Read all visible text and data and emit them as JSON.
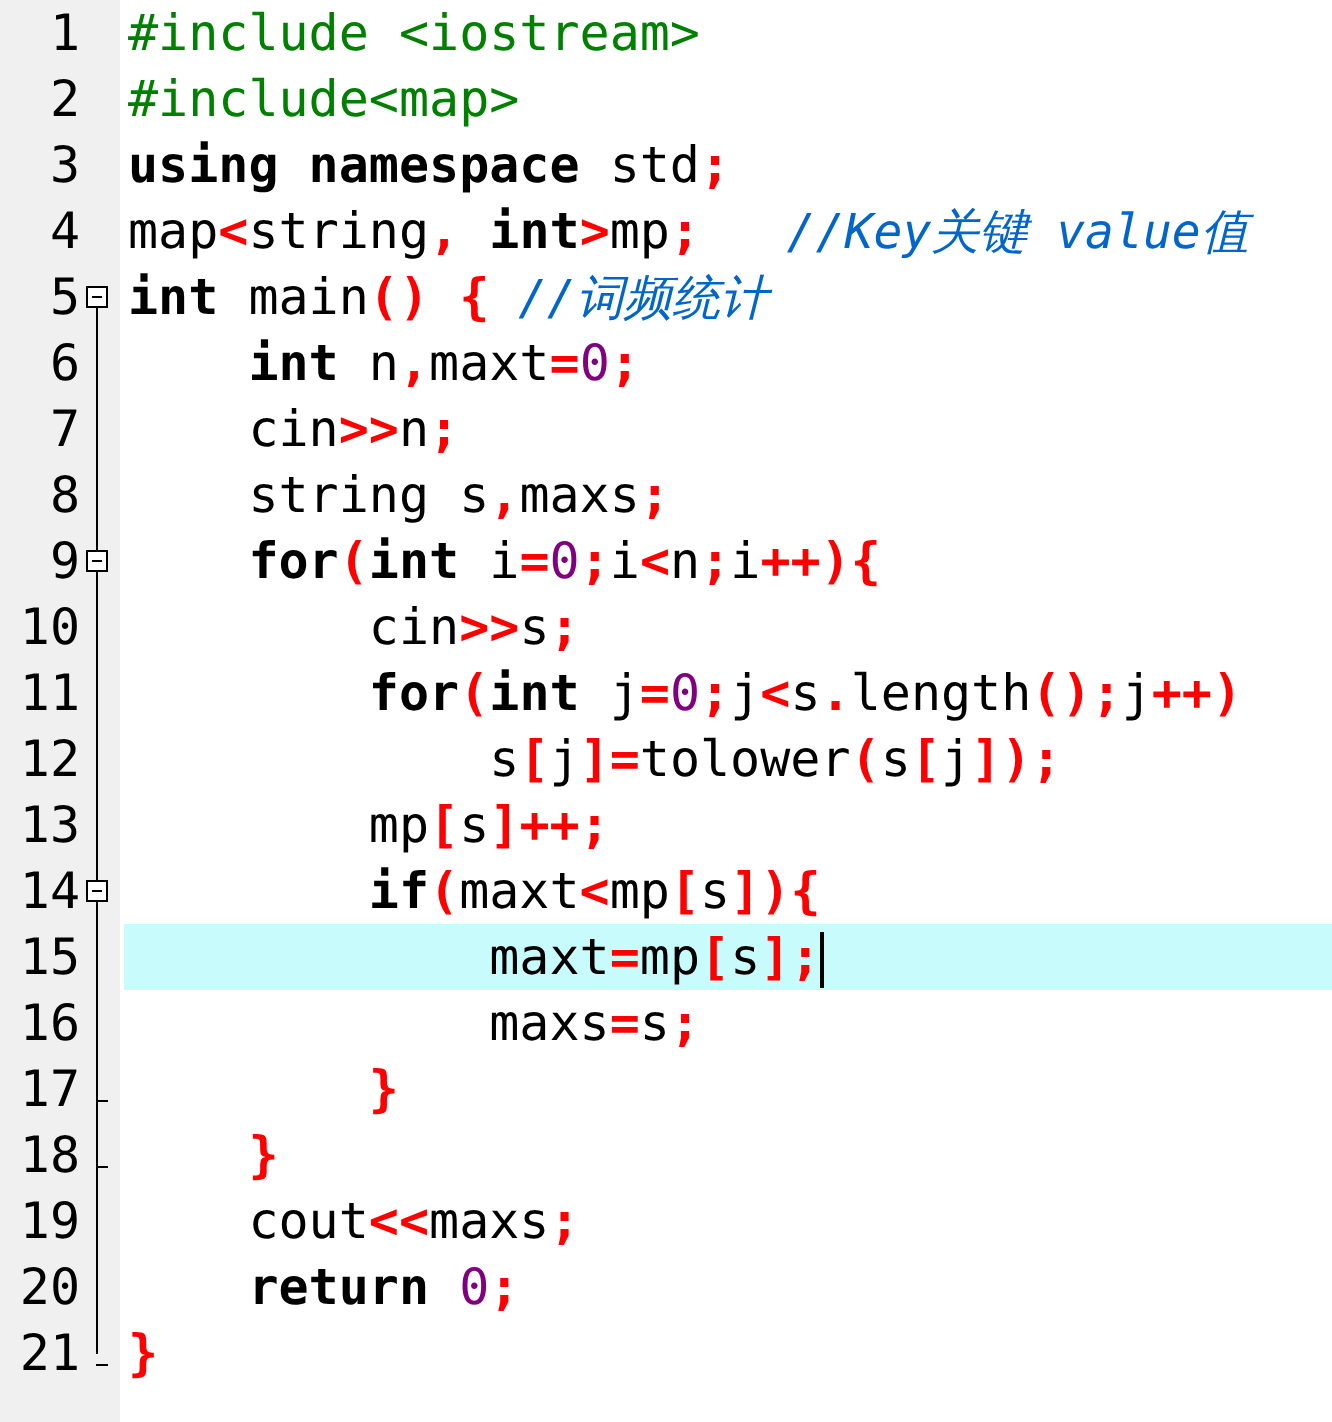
{
  "editor": {
    "lines": [
      {
        "number": "1",
        "kind": "plain",
        "current": false,
        "tokens": [
          {
            "kind": "pre",
            "text": "#include <iostream>"
          }
        ]
      },
      {
        "number": "2",
        "kind": "plain",
        "current": false,
        "tokens": [
          {
            "kind": "pre",
            "text": "#include<map>"
          }
        ]
      },
      {
        "number": "3",
        "kind": "plain",
        "current": false,
        "tokens": [
          {
            "kind": "kw",
            "text": "using namespace"
          },
          {
            "kind": "id",
            "text": " std"
          },
          {
            "kind": "op",
            "text": ";"
          }
        ]
      },
      {
        "number": "4",
        "kind": "plain",
        "current": false,
        "tokens": [
          {
            "kind": "id",
            "text": "map"
          },
          {
            "kind": "op",
            "text": "<"
          },
          {
            "kind": "id",
            "text": "string"
          },
          {
            "kind": "op",
            "text": ","
          },
          {
            "kind": "kw",
            "text": " int"
          },
          {
            "kind": "op",
            "text": ">"
          },
          {
            "kind": "id",
            "text": "mp"
          },
          {
            "kind": "op",
            "text": ";"
          },
          {
            "kind": "cm",
            "text": "   //Key关键 value值"
          }
        ]
      },
      {
        "number": "5",
        "kind": "fold-start",
        "current": false,
        "tokens": [
          {
            "kind": "kw",
            "text": "int"
          },
          {
            "kind": "id",
            "text": " main"
          },
          {
            "kind": "op",
            "text": "() {"
          },
          {
            "kind": "cm",
            "text": " //词频统计"
          }
        ]
      },
      {
        "number": "6",
        "kind": "fold-inside",
        "current": false,
        "tokens": [
          {
            "kind": "kw",
            "text": "    int"
          },
          {
            "kind": "id",
            "text": " n"
          },
          {
            "kind": "op",
            "text": ","
          },
          {
            "kind": "id",
            "text": "maxt"
          },
          {
            "kind": "op",
            "text": "="
          },
          {
            "kind": "num",
            "text": "0"
          },
          {
            "kind": "op",
            "text": ";"
          }
        ]
      },
      {
        "number": "7",
        "kind": "fold-inside",
        "current": false,
        "tokens": [
          {
            "kind": "id",
            "text": "    cin"
          },
          {
            "kind": "op",
            "text": ">>"
          },
          {
            "kind": "id",
            "text": "n"
          },
          {
            "kind": "op",
            "text": ";"
          }
        ]
      },
      {
        "number": "8",
        "kind": "fold-inside",
        "current": false,
        "tokens": [
          {
            "kind": "id",
            "text": "    string s"
          },
          {
            "kind": "op",
            "text": ","
          },
          {
            "kind": "id",
            "text": "maxs"
          },
          {
            "kind": "op",
            "text": ";"
          }
        ]
      },
      {
        "number": "9",
        "kind": "fold-start",
        "current": false,
        "tokens": [
          {
            "kind": "kw",
            "text": "    for"
          },
          {
            "kind": "op",
            "text": "("
          },
          {
            "kind": "kw",
            "text": "int"
          },
          {
            "kind": "id",
            "text": " i"
          },
          {
            "kind": "op",
            "text": "="
          },
          {
            "kind": "num",
            "text": "0"
          },
          {
            "kind": "op",
            "text": ";"
          },
          {
            "kind": "id",
            "text": "i"
          },
          {
            "kind": "op",
            "text": "<"
          },
          {
            "kind": "id",
            "text": "n"
          },
          {
            "kind": "op",
            "text": ";"
          },
          {
            "kind": "id",
            "text": "i"
          },
          {
            "kind": "op",
            "text": "++){"
          }
        ]
      },
      {
        "number": "10",
        "kind": "fold-inside",
        "current": false,
        "tokens": [
          {
            "kind": "id",
            "text": "        cin"
          },
          {
            "kind": "op",
            "text": ">>"
          },
          {
            "kind": "id",
            "text": "s"
          },
          {
            "kind": "op",
            "text": ";"
          }
        ]
      },
      {
        "number": "11",
        "kind": "fold-inside",
        "current": false,
        "tokens": [
          {
            "kind": "kw",
            "text": "        for"
          },
          {
            "kind": "op",
            "text": "("
          },
          {
            "kind": "kw",
            "text": "int"
          },
          {
            "kind": "id",
            "text": " j"
          },
          {
            "kind": "op",
            "text": "="
          },
          {
            "kind": "num",
            "text": "0"
          },
          {
            "kind": "op",
            "text": ";"
          },
          {
            "kind": "id",
            "text": "j"
          },
          {
            "kind": "op",
            "text": "<"
          },
          {
            "kind": "id",
            "text": "s"
          },
          {
            "kind": "op",
            "text": "."
          },
          {
            "kind": "id",
            "text": "length"
          },
          {
            "kind": "op",
            "text": "();"
          },
          {
            "kind": "id",
            "text": "j"
          },
          {
            "kind": "op",
            "text": "++)"
          }
        ]
      },
      {
        "number": "12",
        "kind": "fold-inside",
        "current": false,
        "tokens": [
          {
            "kind": "id",
            "text": "            s"
          },
          {
            "kind": "op",
            "text": "["
          },
          {
            "kind": "id",
            "text": "j"
          },
          {
            "kind": "op",
            "text": "]="
          },
          {
            "kind": "id",
            "text": "tolower"
          },
          {
            "kind": "op",
            "text": "("
          },
          {
            "kind": "id",
            "text": "s"
          },
          {
            "kind": "op",
            "text": "["
          },
          {
            "kind": "id",
            "text": "j"
          },
          {
            "kind": "op",
            "text": "]);"
          }
        ]
      },
      {
        "number": "13",
        "kind": "fold-inside",
        "current": false,
        "tokens": [
          {
            "kind": "id",
            "text": "        mp"
          },
          {
            "kind": "op",
            "text": "["
          },
          {
            "kind": "id",
            "text": "s"
          },
          {
            "kind": "op",
            "text": "]++;"
          }
        ]
      },
      {
        "number": "14",
        "kind": "fold-start",
        "current": false,
        "tokens": [
          {
            "kind": "kw",
            "text": "        if"
          },
          {
            "kind": "op",
            "text": "("
          },
          {
            "kind": "id",
            "text": "maxt"
          },
          {
            "kind": "op",
            "text": "<"
          },
          {
            "kind": "id",
            "text": "mp"
          },
          {
            "kind": "op",
            "text": "["
          },
          {
            "kind": "id",
            "text": "s"
          },
          {
            "kind": "op",
            "text": "]){"
          }
        ]
      },
      {
        "number": "15",
        "kind": "fold-inside",
        "current": true,
        "tokens": [
          {
            "kind": "id",
            "text": "            maxt"
          },
          {
            "kind": "op",
            "text": "="
          },
          {
            "kind": "id",
            "text": "mp"
          },
          {
            "kind": "op",
            "text": "["
          },
          {
            "kind": "id",
            "text": "s"
          },
          {
            "kind": "op",
            "text": "];"
          }
        ]
      },
      {
        "number": "16",
        "kind": "fold-inside",
        "current": false,
        "tokens": [
          {
            "kind": "id",
            "text": "            maxs"
          },
          {
            "kind": "op",
            "text": "="
          },
          {
            "kind": "id",
            "text": "s"
          },
          {
            "kind": "op",
            "text": ";"
          }
        ]
      },
      {
        "number": "17",
        "kind": "fold-end",
        "current": false,
        "tokens": [
          {
            "kind": "op",
            "text": "        }"
          }
        ]
      },
      {
        "number": "18",
        "kind": "fold-end",
        "current": false,
        "tokens": [
          {
            "kind": "op",
            "text": "    }"
          }
        ]
      },
      {
        "number": "19",
        "kind": "fold-inside",
        "current": false,
        "tokens": [
          {
            "kind": "id",
            "text": "    cout"
          },
          {
            "kind": "op",
            "text": "<<"
          },
          {
            "kind": "id",
            "text": "maxs"
          },
          {
            "kind": "op",
            "text": ";"
          }
        ]
      },
      {
        "number": "20",
        "kind": "fold-inside",
        "current": false,
        "tokens": [
          {
            "kind": "kw",
            "text": "    return"
          },
          {
            "kind": "num",
            "text": " 0"
          },
          {
            "kind": "op",
            "text": ";"
          }
        ]
      },
      {
        "number": "21",
        "kind": "fold-last",
        "current": false,
        "tokens": [
          {
            "kind": "op",
            "text": "}"
          }
        ]
      }
    ]
  }
}
